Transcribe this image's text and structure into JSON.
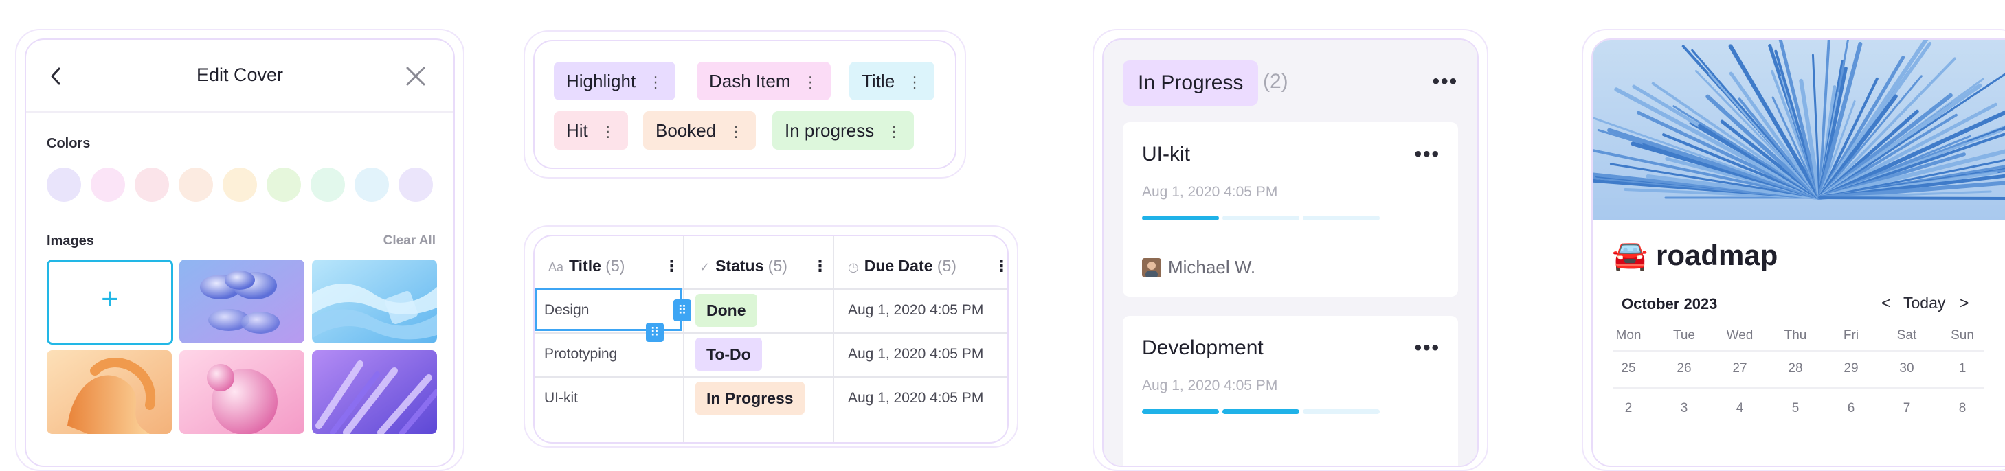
{
  "edit_cover": {
    "title": "Edit Cover",
    "colors_label": "Colors",
    "images_label": "Images",
    "clear_all": "Clear All",
    "add_symbol": "+",
    "swatches": [
      "#e9e4fb",
      "#fbe4f7",
      "#fbe4ea",
      "#fcebe1",
      "#fdf0d8",
      "#e6f7dc",
      "#e2f8ec",
      "#e2f3fb",
      "#ebe5fb"
    ]
  },
  "tags": {
    "items": [
      {
        "label": "Highlight",
        "color": "#e8dcff"
      },
      {
        "label": "Dash Item",
        "color": "#fbdcf6"
      },
      {
        "label": "Title",
        "color": "#dcf4fb"
      },
      {
        "label": "Hit",
        "color": "#fde3ea"
      },
      {
        "label": "Booked",
        "color": "#fde9dc"
      },
      {
        "label": "In progress",
        "color": "#ddf7dc"
      }
    ],
    "menu_symbol": "⋮"
  },
  "table": {
    "columns": [
      {
        "icon": "Aa",
        "label": "Title",
        "count": "(5)"
      },
      {
        "icon": "✓",
        "label": "Status",
        "count": "(5)"
      },
      {
        "icon": "◷",
        "label": "Due Date",
        "count": "(5)"
      }
    ],
    "rows": [
      {
        "title": "Design",
        "status": "Done",
        "status_color": "#dcf6d6",
        "due": "Aug 1, 2020 4:05 PM"
      },
      {
        "title": "Prototyping",
        "status": "To-Do",
        "status_color": "#e9dcff",
        "due": "Aug 1, 2020 4:05 PM"
      },
      {
        "title": "UI-kit",
        "status": "In Progress",
        "status_color": "#fde7d7",
        "due": "Aug 1, 2020 4:05 PM"
      }
    ]
  },
  "in_progress": {
    "label": "In Progress",
    "count": "(2)",
    "menu": "•••",
    "cards": [
      {
        "title": "UI-kit",
        "date": "Aug 1, 2020 4:05 PM",
        "progress": 0.33,
        "assignee": "Michael W."
      },
      {
        "title": "Development",
        "date": "Aug 1, 2020 4:05 PM",
        "progress": 0.66
      }
    ]
  },
  "roadmap": {
    "emoji": "🚘",
    "title": "roadmap",
    "month": "October 2023",
    "prev": "<",
    "today": "Today",
    "next": ">",
    "dow": [
      "Mon",
      "Tue",
      "Wed",
      "Thu",
      "Fri",
      "Sat",
      "Sun"
    ],
    "week1": [
      "25",
      "26",
      "27",
      "28",
      "29",
      "30",
      "1"
    ],
    "week2": [
      "2",
      "3",
      "4",
      "5",
      "6",
      "7",
      "8"
    ]
  }
}
